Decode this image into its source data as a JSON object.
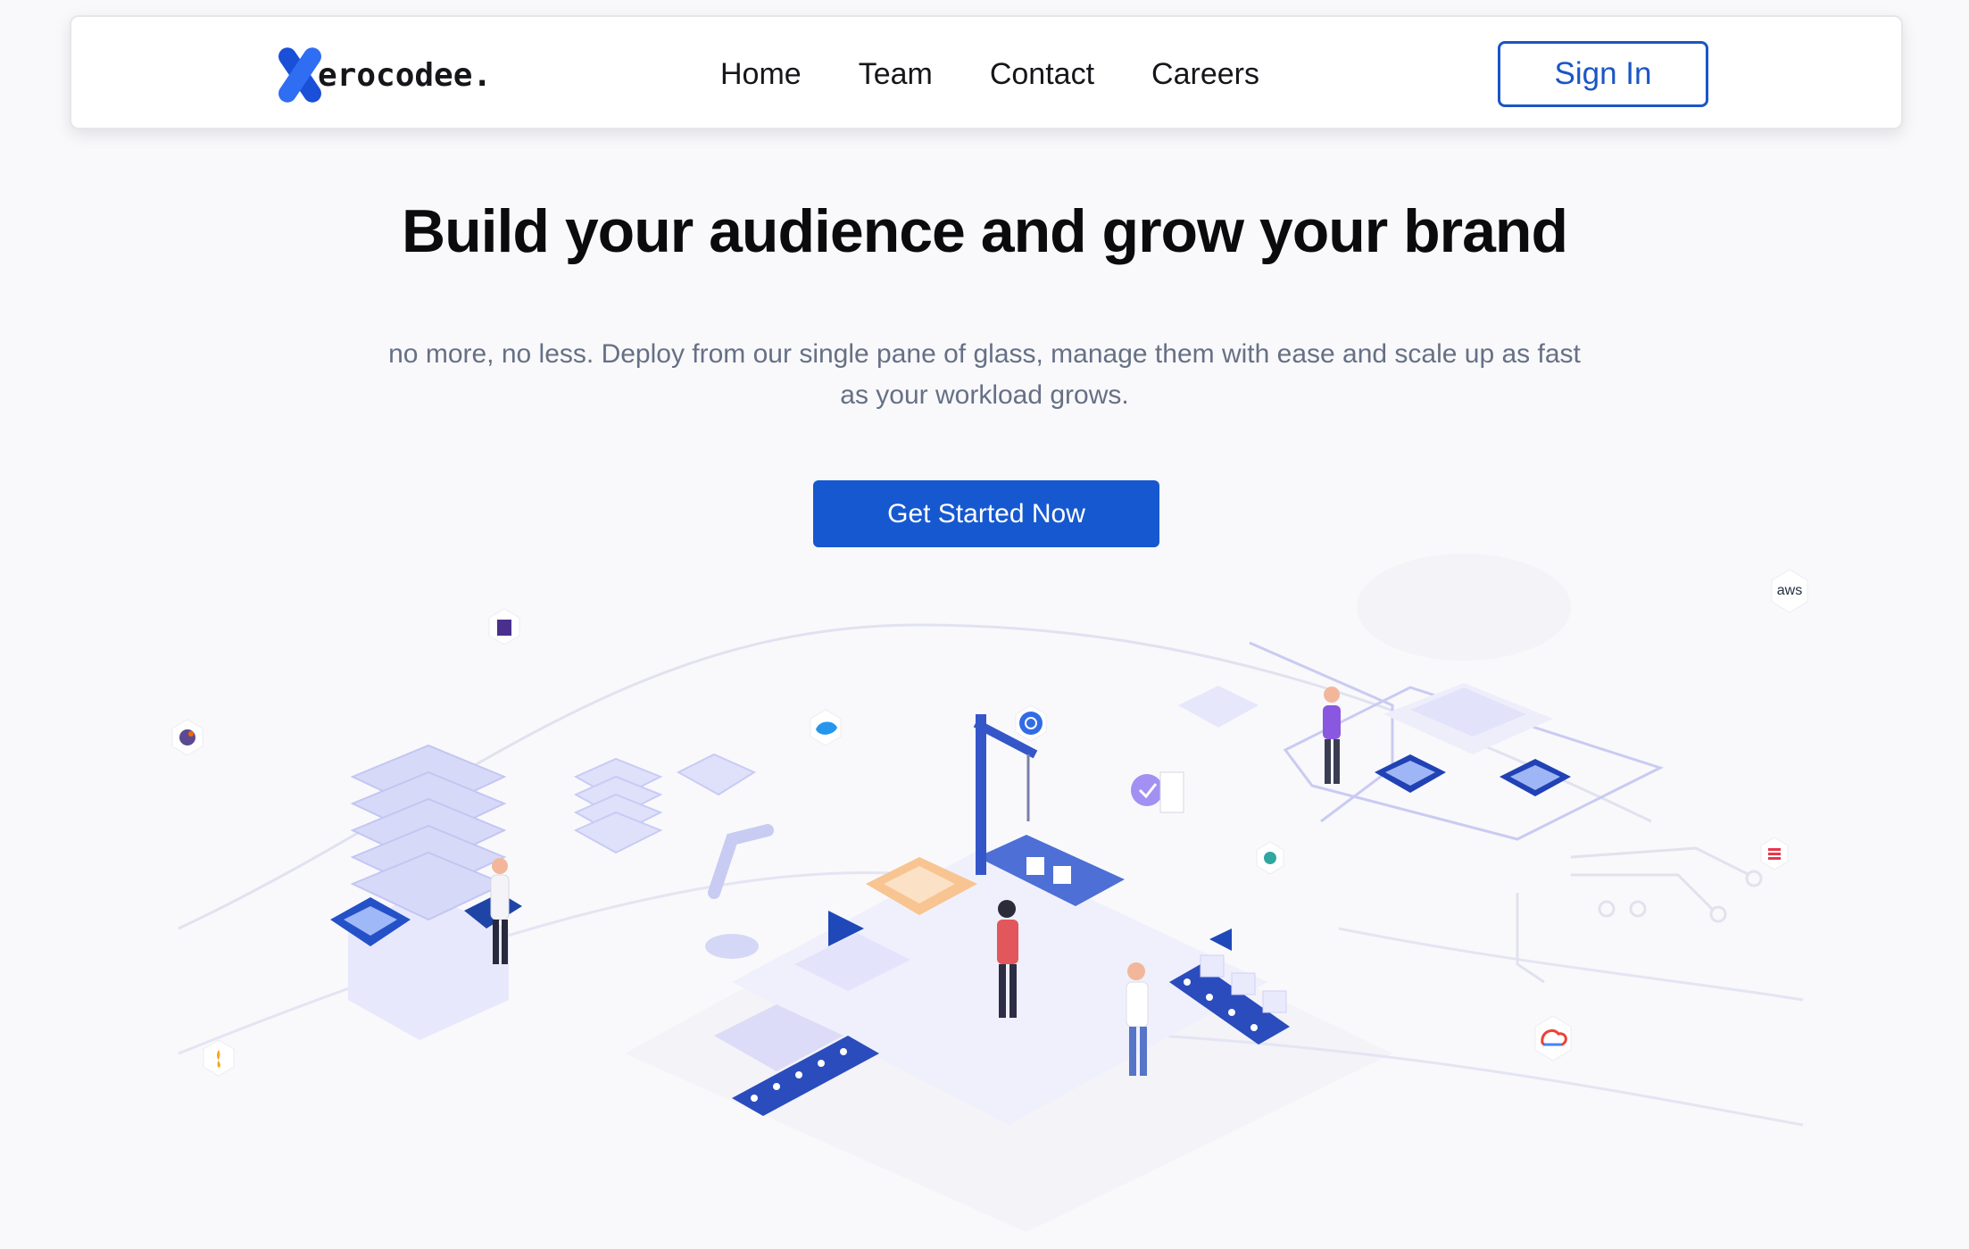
{
  "brand": {
    "logo_letter": "X",
    "logo_text": "erocodee."
  },
  "nav": {
    "items": [
      {
        "label": "Home"
      },
      {
        "label": "Team"
      },
      {
        "label": "Contact"
      },
      {
        "label": "Careers"
      }
    ],
    "sign_in_label": "Sign In"
  },
  "hero": {
    "title": "Build your audience and grow your brand",
    "subtitle": "no more, no less. Deploy from our single pane of glass, manage them with ease and scale up as fast as your workload grows.",
    "cta_label": "Get Started Now"
  },
  "illustration": {
    "badges": [
      {
        "icon": "aws-icon",
        "label": "aws"
      },
      {
        "icon": "kubernetes-icon"
      },
      {
        "icon": "docker-icon"
      },
      {
        "icon": "google-cloud-icon"
      },
      {
        "icon": "terraform-icon"
      },
      {
        "icon": "grafana-icon"
      },
      {
        "icon": "prometheus-icon"
      },
      {
        "icon": "helm-icon"
      },
      {
        "icon": "ansible-icon"
      }
    ]
  },
  "colors": {
    "primary": "#1658cf",
    "outline": "#1a56c4",
    "text_dark": "#0b0b0d",
    "text_muted": "#667085",
    "background": "#f9f9fb"
  }
}
